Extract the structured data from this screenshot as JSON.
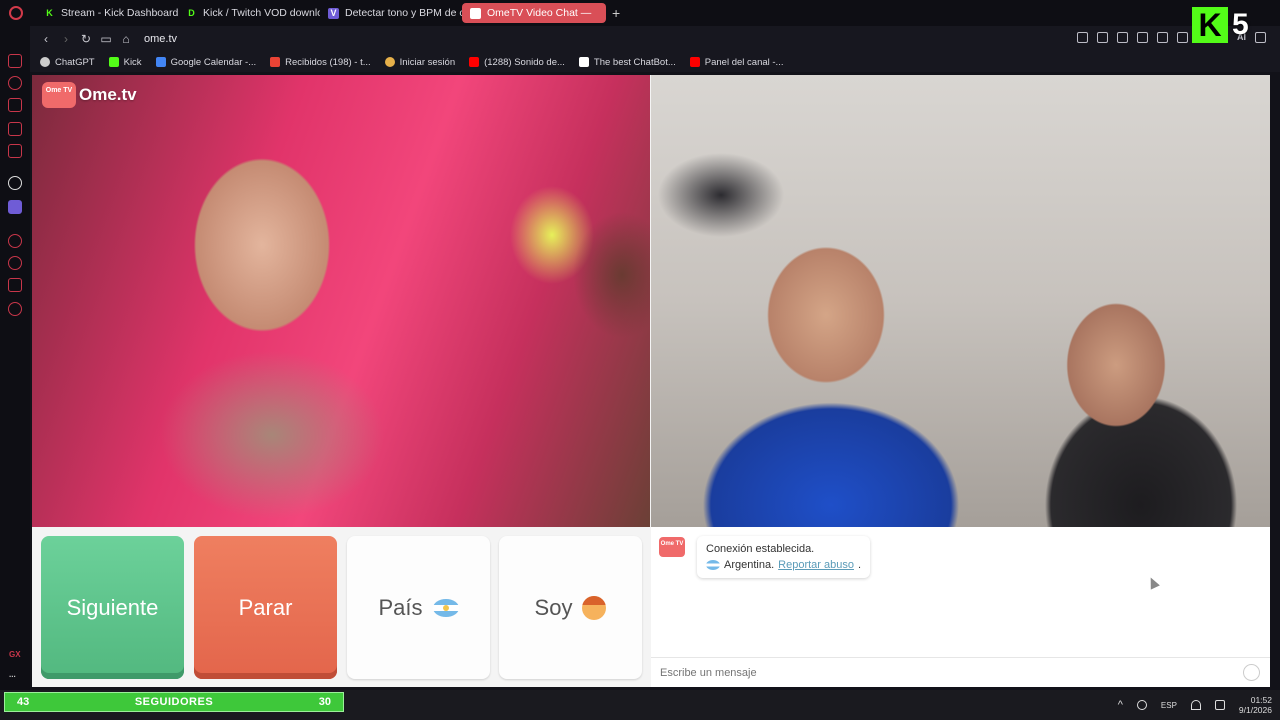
{
  "tabs": [
    {
      "label": "Stream - Kick Dashboard",
      "icon": "kick-icon",
      "color": "#53fc18",
      "glyph": "K",
      "active": false
    },
    {
      "label": "Kick / Twitch VOD downlo",
      "icon": "download-icon",
      "color": "#53fc18",
      "glyph": "D",
      "active": false
    },
    {
      "label": "Detectar tono y BPM de c",
      "icon": "music-icon",
      "color": "#6f5cd6",
      "glyph": "V",
      "active": false
    },
    {
      "label": "OmeTV Video Chat —",
      "icon": "ometv-icon",
      "color": "#ffffff",
      "glyph": "",
      "active": true
    }
  ],
  "new_tab": "+",
  "address": {
    "url": "ome.tv"
  },
  "bookmarks": [
    {
      "label": "ChatGPT",
      "icon": "chatgpt-icon",
      "color": "#cccccc"
    },
    {
      "label": "Kick",
      "icon": "kick-icon",
      "color": "#53fc18"
    },
    {
      "label": "Google Calendar -...",
      "icon": "calendar-icon",
      "color": "#4285f4"
    },
    {
      "label": "Recibidos (198) - t...",
      "icon": "gmail-icon",
      "color": "#ea4335"
    },
    {
      "label": "Iniciar sesión",
      "icon": "login-icon",
      "color": "#e6b04a"
    },
    {
      "label": "(1288) Sonido de...",
      "icon": "youtube-icon",
      "color": "#ff0000"
    },
    {
      "label": "The best ChatBot...",
      "icon": "chatbot-icon",
      "color": "#ffffff"
    },
    {
      "label": "Panel del canal -...",
      "icon": "youtube-icon",
      "color": "#ff0000"
    }
  ],
  "app": {
    "logo_tv": "Ome TV",
    "logo_name": "Ome.tv",
    "buttons": {
      "next": "Siguiente",
      "stop": "Parar",
      "country": "País",
      "gender": "Soy"
    },
    "chat": {
      "logo": "Ome TV",
      "status": "Conexión establecida.",
      "country": "Argentina.",
      "report": "Reportar abuso",
      "report_suffix": ".",
      "placeholder": "Escribe un mensaje"
    }
  },
  "sidebar": {
    "bottom_label": "GX",
    "more": "..."
  },
  "overlay": {
    "followers_current": "43",
    "followers_label": "SEGUIDORES",
    "followers_goal": "30",
    "followers_progress": 1.0,
    "kick_letter": "K",
    "kick_number": "5"
  },
  "taskbar": {
    "lang": "ESP",
    "time": "01:52",
    "date": "9/1/2026"
  },
  "colors": {
    "accent_tab": "#d94f57",
    "next": "#5cc58b",
    "stop": "#e96e52",
    "followers": "#3ec83a",
    "kick": "#53fc18"
  }
}
